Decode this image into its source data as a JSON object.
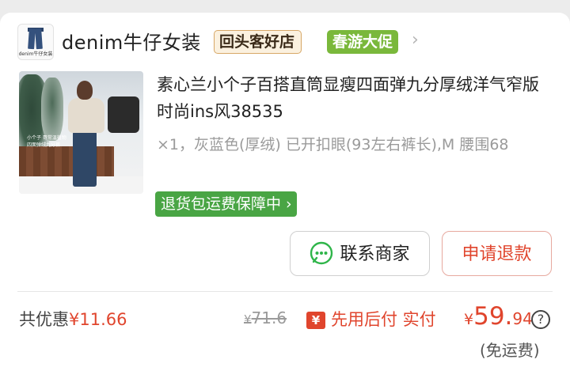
{
  "shop": {
    "logo_text": "denim牛仔女装",
    "name": "denim牛仔女装",
    "badge_loyal": "回头客好店",
    "badge_promo": "春游大促",
    "chevron": "›"
  },
  "product": {
    "image_overlay_lines": [
      "小个子 哥常温植物",
      "四面弹绒九分裤"
    ],
    "title": "素心兰小个子百搭直筒显瘦四面弹九分厚绒洋气窄版时尚ins风38535",
    "specs": "×1，灰蓝色(厚绒) 已开扣眼(93左右裤长),M 腰围68",
    "guarantee": "退货包运费保障中 ›"
  },
  "actions": {
    "contact_label": "联系商家",
    "refund_label": "申请退款"
  },
  "summary": {
    "discount_label": "共优惠",
    "discount_amount": "¥11.66",
    "original_symbol": "¥",
    "original_price": "71.6",
    "pay_later_icon": "¥",
    "pay_later_label": "先用后付 实付",
    "actual_symbol": "¥",
    "actual_integer": "59.",
    "actual_decimal": "94",
    "help_glyph": "?",
    "shipping_note": "(免运费)"
  },
  "colors": {
    "accent_red": "#e0452d",
    "guarantee_green": "#49a544",
    "promo_green": "#7ab83b"
  },
  "icons": [
    "wechat-icon",
    "chevron-right-icon",
    "pay-later-icon",
    "help-icon"
  ]
}
